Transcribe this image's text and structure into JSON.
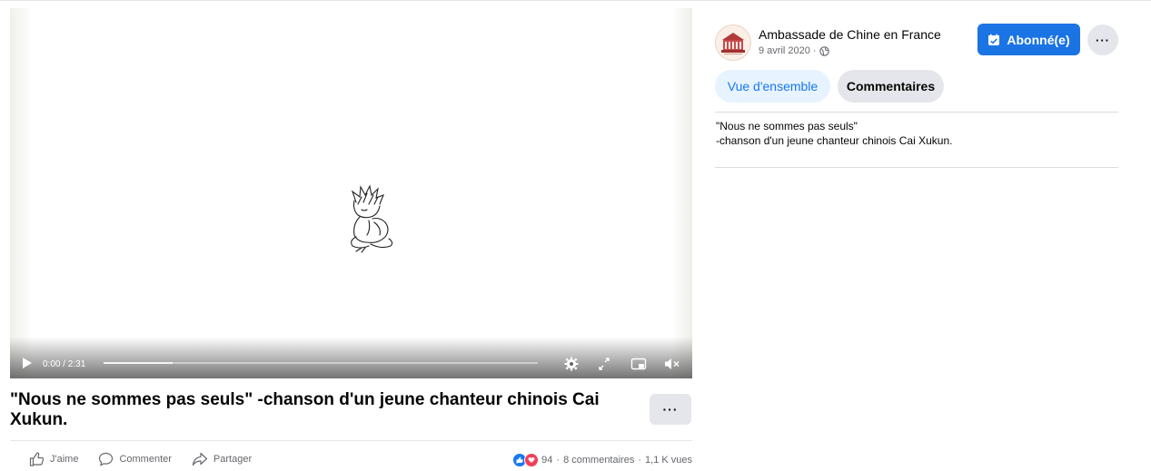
{
  "video": {
    "time": "0:00 / 2:31",
    "progress_fraction": 0
  },
  "post": {
    "title": "\"Nous ne sommes pas seuls\" -chanson d'un jeune chanteur chinois Cai Xukun.",
    "more_label": "···"
  },
  "actions": {
    "like": "J'aime",
    "comment": "Commenter",
    "share": "Partager"
  },
  "stats": {
    "reactions": "94",
    "comments": "8 commentaires",
    "views": "1,1 K vues",
    "separator": "·"
  },
  "page": {
    "name": "Ambassade de Chine en France",
    "date": "9 avril 2020 ·",
    "subscribe_label": "Abonné(e)",
    "more_label": "···"
  },
  "tabs": {
    "overview": "Vue d'ensemble",
    "comments": "Commentaires"
  },
  "description": {
    "line1": "\"Nous ne sommes pas seuls\"",
    "line2": "-chanson d'un jeune chanteur chinois Cai Xukun."
  },
  "colors": {
    "accent": "#1b74e4",
    "tab_active_bg": "#e7f3ff",
    "secondary_text": "#65676b"
  },
  "icons": {
    "play": "play-icon",
    "settings": "gear-icon",
    "fullscreen": "expand-icon",
    "pip": "picture-in-picture-icon",
    "volume": "volume-muted-icon",
    "like": "thumbs-up-icon",
    "comment": "speech-bubble-icon",
    "share": "share-arrow-icon",
    "subscribed": "check-calendar-icon",
    "globe": "globe-icon"
  }
}
